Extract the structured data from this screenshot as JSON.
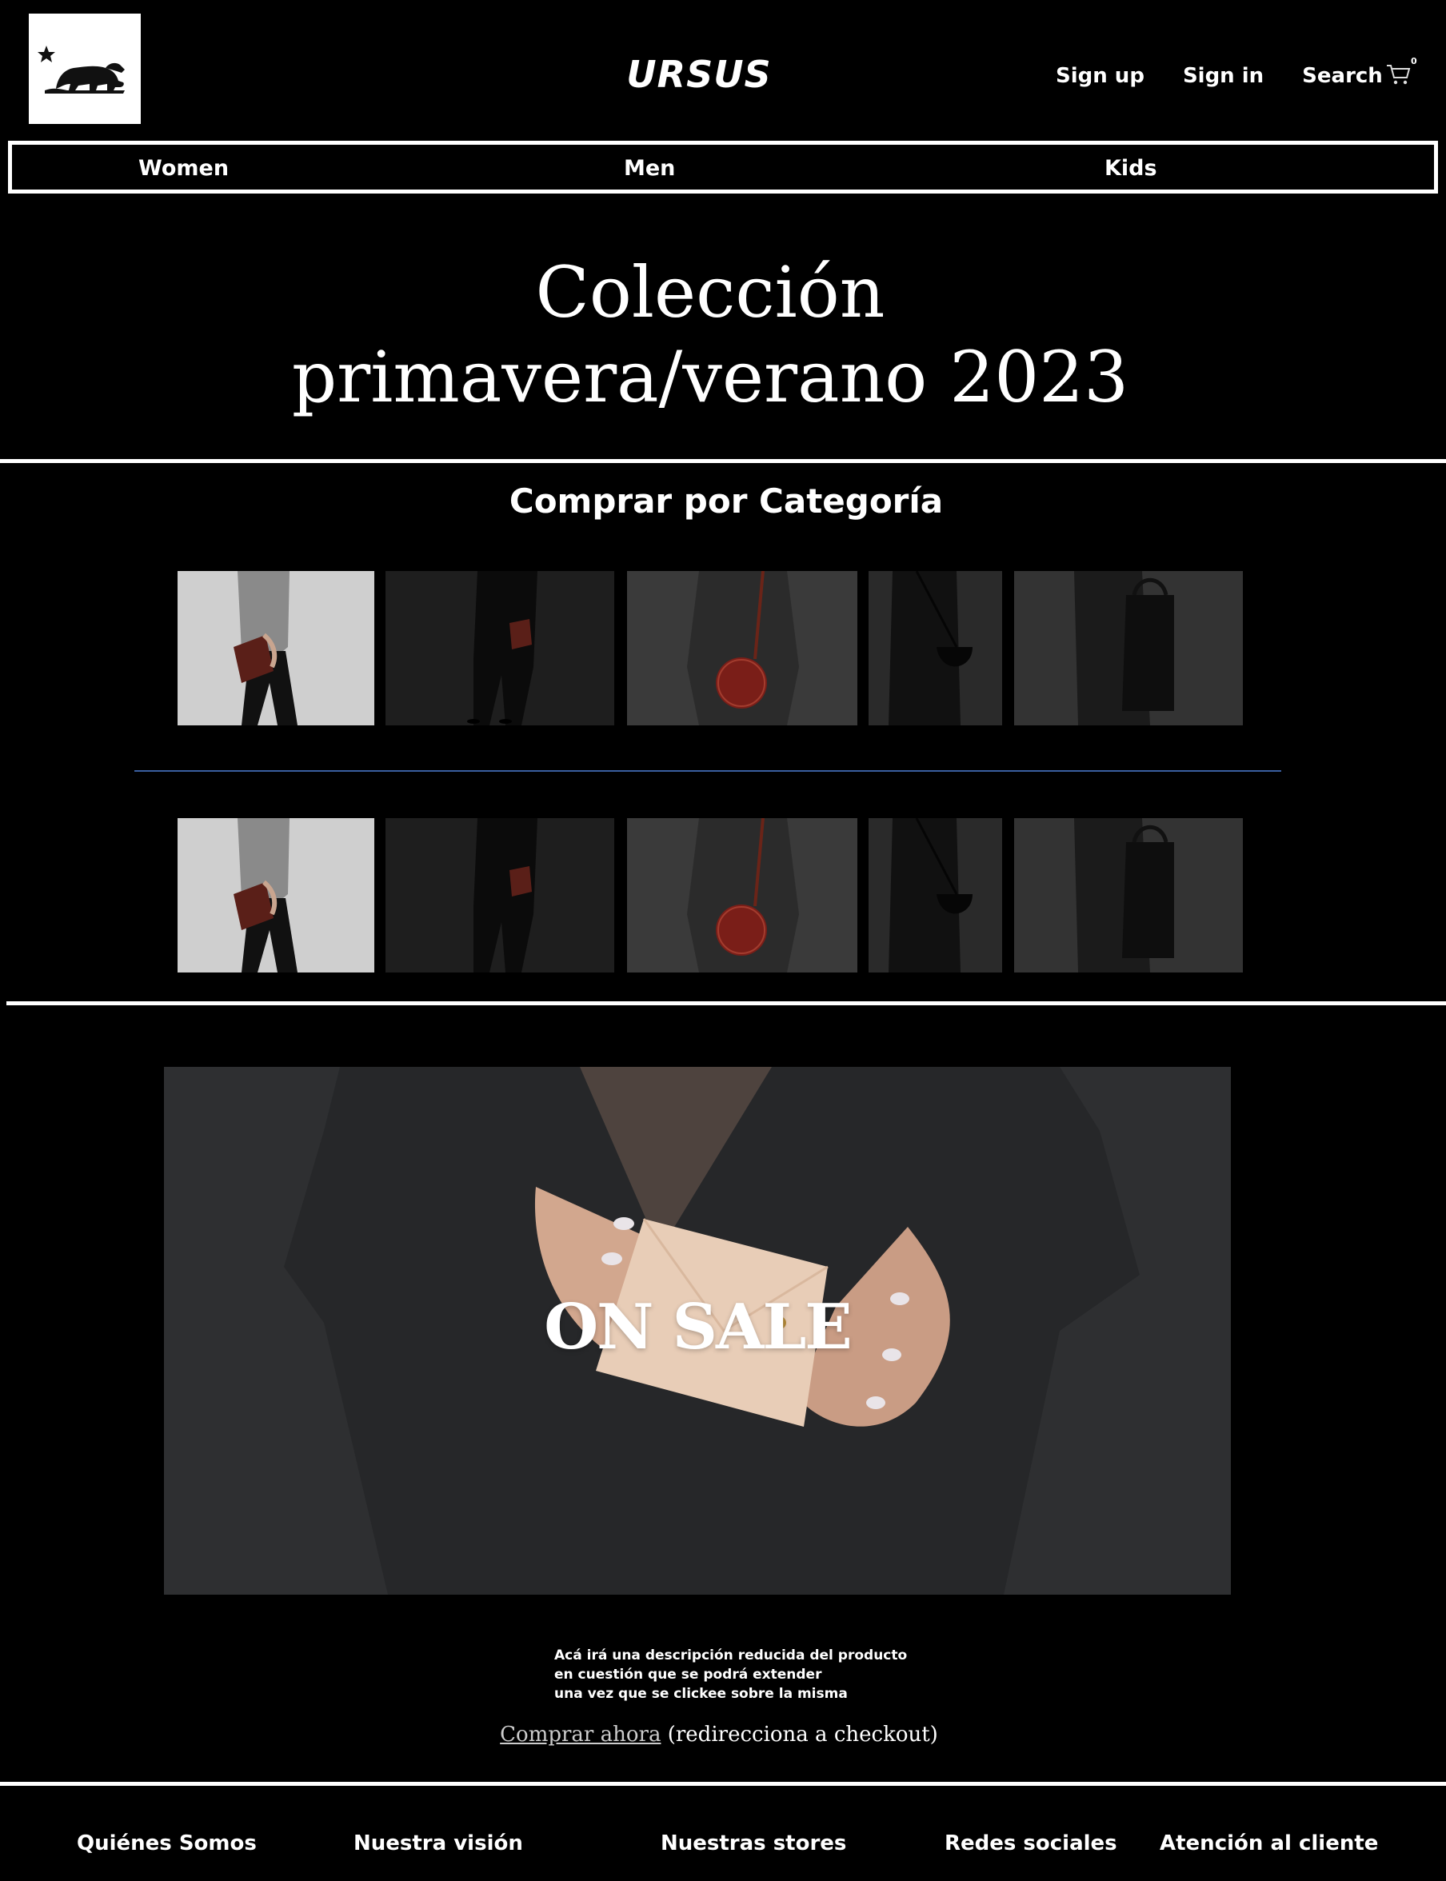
{
  "header": {
    "brand": "URSUS",
    "links": {
      "signup": "Sign up",
      "signin": "Sign in",
      "search": "Search"
    },
    "cart_count": "0"
  },
  "nav": {
    "women": "Women",
    "men": "Men",
    "kids": "Kids"
  },
  "hero": {
    "title_line1": "Colección",
    "title_line2": "primavera/verano 2023"
  },
  "categories": {
    "title": "Comprar por Categoría"
  },
  "banner": {
    "label": "ON SALE"
  },
  "product": {
    "desc_line1": "Acá irá una descripción reducida del producto",
    "desc_line2": "en cuestión que se podrá extender",
    "desc_line3": "una vez que se clickee sobre la misma",
    "buy_link": "Comprar ahora",
    "buy_note": " (redirecciona a checkout)"
  },
  "footer": {
    "about": "Quiénes Somos",
    "vision": "Nuestra visión",
    "stores": "Nuestras stores",
    "social": "Redes sociales",
    "support": "Atención al cliente"
  },
  "colors": {
    "background": "#000000",
    "text": "#ffffff",
    "divider_blue": "#3a5fa0"
  }
}
